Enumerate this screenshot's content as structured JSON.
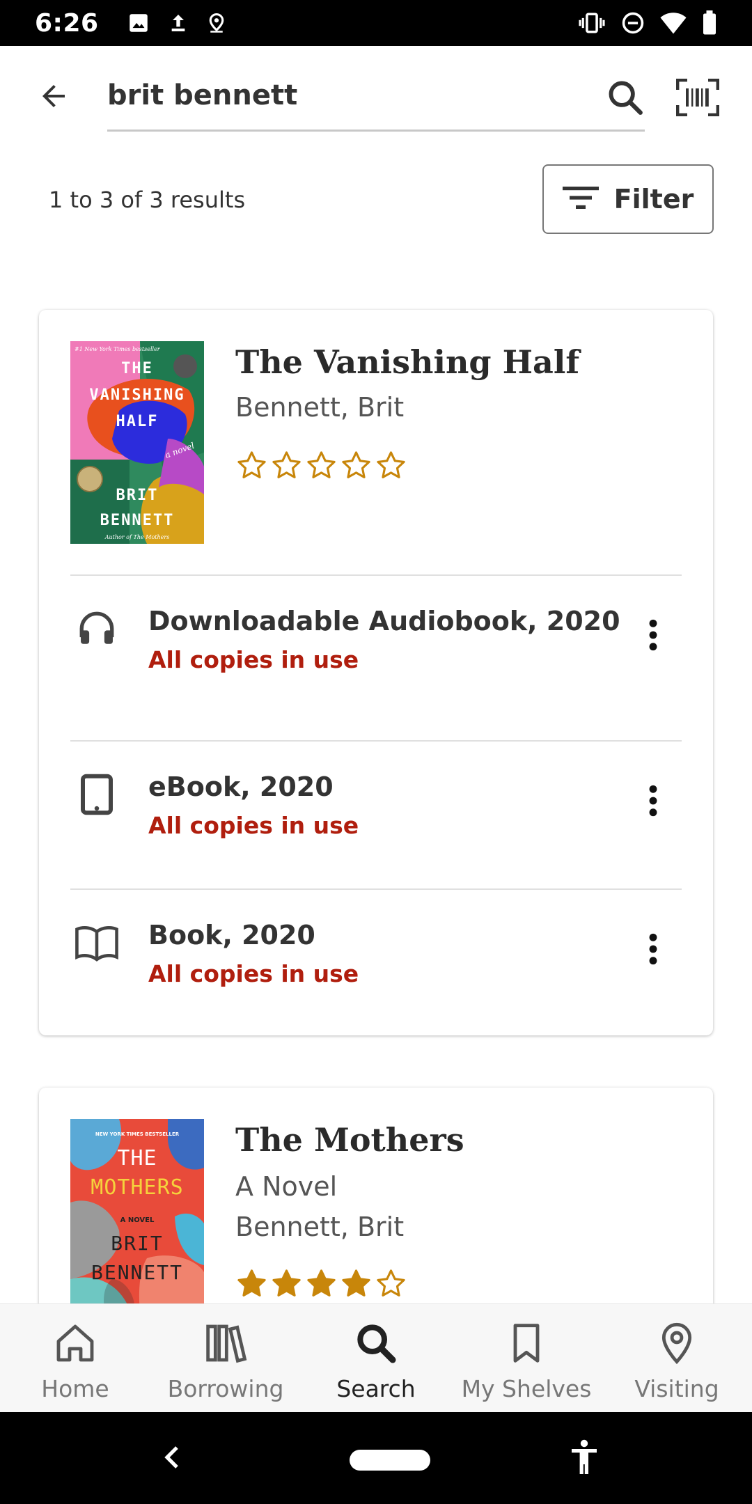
{
  "status_bar": {
    "time": "6:26",
    "left_icons": [
      "image-icon",
      "upload-icon",
      "location-icon"
    ],
    "right_icons": [
      "vibrate-icon",
      "do-not-disturb-icon",
      "wifi-icon",
      "battery-icon"
    ]
  },
  "search": {
    "query": "brit bennett",
    "back_icon": "arrow-back-icon",
    "search_icon": "search-icon",
    "barcode_icon": "barcode-scan-icon"
  },
  "results": {
    "count_text": "1 to 3 of 3 results",
    "filter_label": "Filter"
  },
  "items": [
    {
      "title": "The Vanishing Half",
      "author": "Bennett, Brit",
      "rating": 0,
      "rating_max": 5,
      "formats": [
        {
          "name": "Downloadable Audiobook, 2020",
          "status": "All copies in use",
          "icon": "headphones-icon"
        },
        {
          "name": "eBook, 2020",
          "status": "All copies in use",
          "icon": "tablet-icon"
        },
        {
          "name": "Book, 2020",
          "status": "All copies in use",
          "icon": "open-book-icon"
        }
      ],
      "cover": {
        "badge": "#1 New York Times bestseller",
        "title_lines": [
          "THE",
          "VANISHING",
          "HALF"
        ],
        "tagline": "a novel",
        "author_lines": [
          "BRIT",
          "BENNETT"
        ],
        "footer": "Author of The Mothers"
      }
    },
    {
      "title": "The Mothers",
      "subtitle": "A Novel",
      "author": "Bennett, Brit",
      "rating": 4,
      "rating_max": 5,
      "cover": {
        "badge": "NEW YORK TIMES BESTSELLER",
        "title_lines": [
          "THE",
          "MOTHERS"
        ],
        "tagline": "A NOVEL",
        "author_lines": [
          "BRIT",
          "BENNETT"
        ]
      }
    }
  ],
  "bottom_nav": [
    {
      "label": "Home",
      "icon": "home-icon",
      "active": false
    },
    {
      "label": "Borrowing",
      "icon": "books-icon",
      "active": false
    },
    {
      "label": "Search",
      "icon": "search-icon",
      "active": true
    },
    {
      "label": "My Shelves",
      "icon": "bookmark-icon",
      "active": false
    },
    {
      "label": "Visiting",
      "icon": "location-pin-icon",
      "active": false
    }
  ],
  "colors": {
    "unavailable_status": "#b01e0e",
    "star": "#c8860a",
    "active_nav": "#222222",
    "inactive_nav": "#777777"
  }
}
